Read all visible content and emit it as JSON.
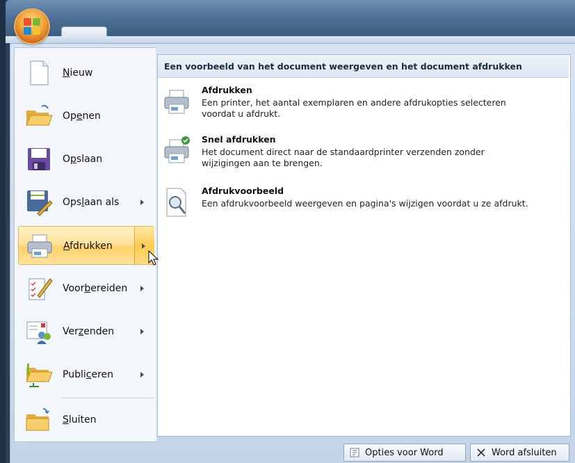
{
  "menu": {
    "items": [
      {
        "label": "Nieuw",
        "accel": "N",
        "has_submenu": false
      },
      {
        "label": "Openen",
        "accel": "e",
        "has_submenu": false
      },
      {
        "label": "Opslaan",
        "accel": "p",
        "has_submenu": false
      },
      {
        "label": "Opslaan als",
        "accel": "l",
        "has_submenu": true
      },
      {
        "label": "Afdrukken",
        "accel": "A",
        "has_submenu": true,
        "active": true
      },
      {
        "label": "Voorbereiden",
        "accel": "b",
        "has_submenu": true
      },
      {
        "label": "Verzenden",
        "accel": "z",
        "has_submenu": true
      },
      {
        "label": "Publiceren",
        "accel": "c",
        "has_submenu": true
      },
      {
        "label": "Sluiten",
        "accel": "S",
        "has_submenu": false
      }
    ]
  },
  "submenu": {
    "header": "Een voorbeeld van het document weergeven en het document afdrukken",
    "items": [
      {
        "title": "Afdrukken",
        "description": "Een printer, het aantal exemplaren en andere afdrukopties selecteren voordat u afdrukt."
      },
      {
        "title": "Snel afdrukken",
        "description": "Het document direct naar de standaardprinter verzenden zonder wijzigingen aan te brengen."
      },
      {
        "title": "Afdrukvoorbeeld",
        "description": "Een afdrukvoorbeeld weergeven en pagina's wijzigen voordat u ze afdrukt."
      }
    ]
  },
  "footer": {
    "options_label": "Opties voor Word",
    "exit_label": "Word afsluiten"
  },
  "colors": {
    "active_highlight": "#ffd26b",
    "frame": "#c4d4e8",
    "title_bar": "#4f7195"
  },
  "icons": {
    "new": "new-document-icon",
    "open": "open-folder-icon",
    "save": "floppy-disk-icon",
    "save_as": "save-as-icon",
    "print": "printer-icon",
    "prepare": "checklist-pen-icon",
    "send": "send-people-icon",
    "publish": "publish-folder-icon",
    "close": "close-folder-icon"
  }
}
